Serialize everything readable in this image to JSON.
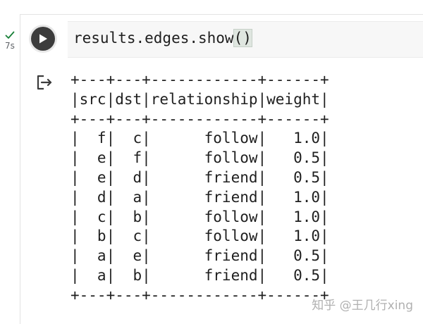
{
  "cell": {
    "status_icon": "check-icon",
    "exec_time": "7s",
    "run_icon": "play-icon",
    "code": "results.edges.show",
    "code_parens": "()"
  },
  "output": {
    "icon": "output-redirect-icon",
    "lines": [
      "+---+---+------------+------+",
      "|src|dst|relationship|weight|",
      "+---+---+------------+------+",
      "|  f|  c|      follow|   1.0|",
      "|  e|  f|      follow|   0.5|",
      "|  e|  d|      friend|   0.5|",
      "|  d|  a|      friend|   1.0|",
      "|  c|  b|      follow|   1.0|",
      "|  b|  c|      follow|   1.0|",
      "|  a|  e|      friend|   0.5|",
      "|  a|  b|      friend|   0.5|",
      "+---+---+------------+------+"
    ]
  },
  "watermark": "知乎 @王几行xing",
  "colors": {
    "check": "#188038",
    "run_button": "#3c3c3c",
    "code_bg": "#f7f7f7"
  }
}
